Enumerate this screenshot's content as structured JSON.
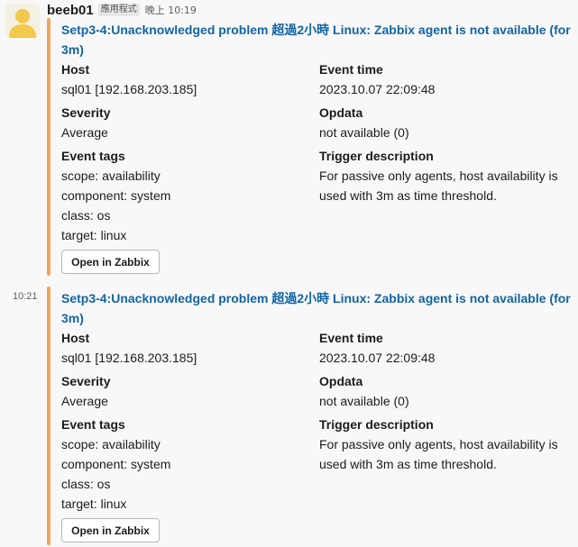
{
  "message": {
    "username": "beeb01",
    "app_badge": "應用程式",
    "time": "晚上 10:19"
  },
  "colors": {
    "attachment_bar": "#f0a55c",
    "link": "#1264a3",
    "avatar_bg": "#f4f0e2",
    "avatar_figure": "#f2c94c"
  },
  "icons": {
    "avatar": "user-silhouette-icon"
  },
  "attachments": [
    {
      "hover_time": "",
      "title": "Setp3-4:Unacknowledged problem 超過2小時 Linux: Zabbix agent is not available (for 3m)",
      "host_label": "Host",
      "host_value": "sql01 [192.168.203.185]",
      "event_time_label": "Event time",
      "event_time_value": "2023.10.07 22:09:48",
      "severity_label": "Severity",
      "severity_value": "Average",
      "opdata_label": "Opdata",
      "opdata_value": "not available (0)",
      "event_tags_label": "Event tags",
      "event_tags": [
        "scope: availability",
        "component: system",
        "class: os",
        "target: linux"
      ],
      "trigger_label": "Trigger description",
      "trigger_value": "For passive only agents, host availability is used with 3m as time threshold.",
      "button_label": "Open in Zabbix"
    },
    {
      "hover_time": "10:21",
      "title": "Setp3-4:Unacknowledged problem 超過2小時 Linux: Zabbix agent is not available (for 3m)",
      "host_label": "Host",
      "host_value": "sql01 [192.168.203.185]",
      "event_time_label": "Event time",
      "event_time_value": "2023.10.07 22:09:48",
      "severity_label": "Severity",
      "severity_value": "Average",
      "opdata_label": "Opdata",
      "opdata_value": "not available (0)",
      "event_tags_label": "Event tags",
      "event_tags": [
        "scope: availability",
        "component: system",
        "class: os",
        "target: linux"
      ],
      "trigger_label": "Trigger description",
      "trigger_value": "For passive only agents, host availability is used with 3m as time threshold.",
      "button_label": "Open in Zabbix"
    }
  ]
}
